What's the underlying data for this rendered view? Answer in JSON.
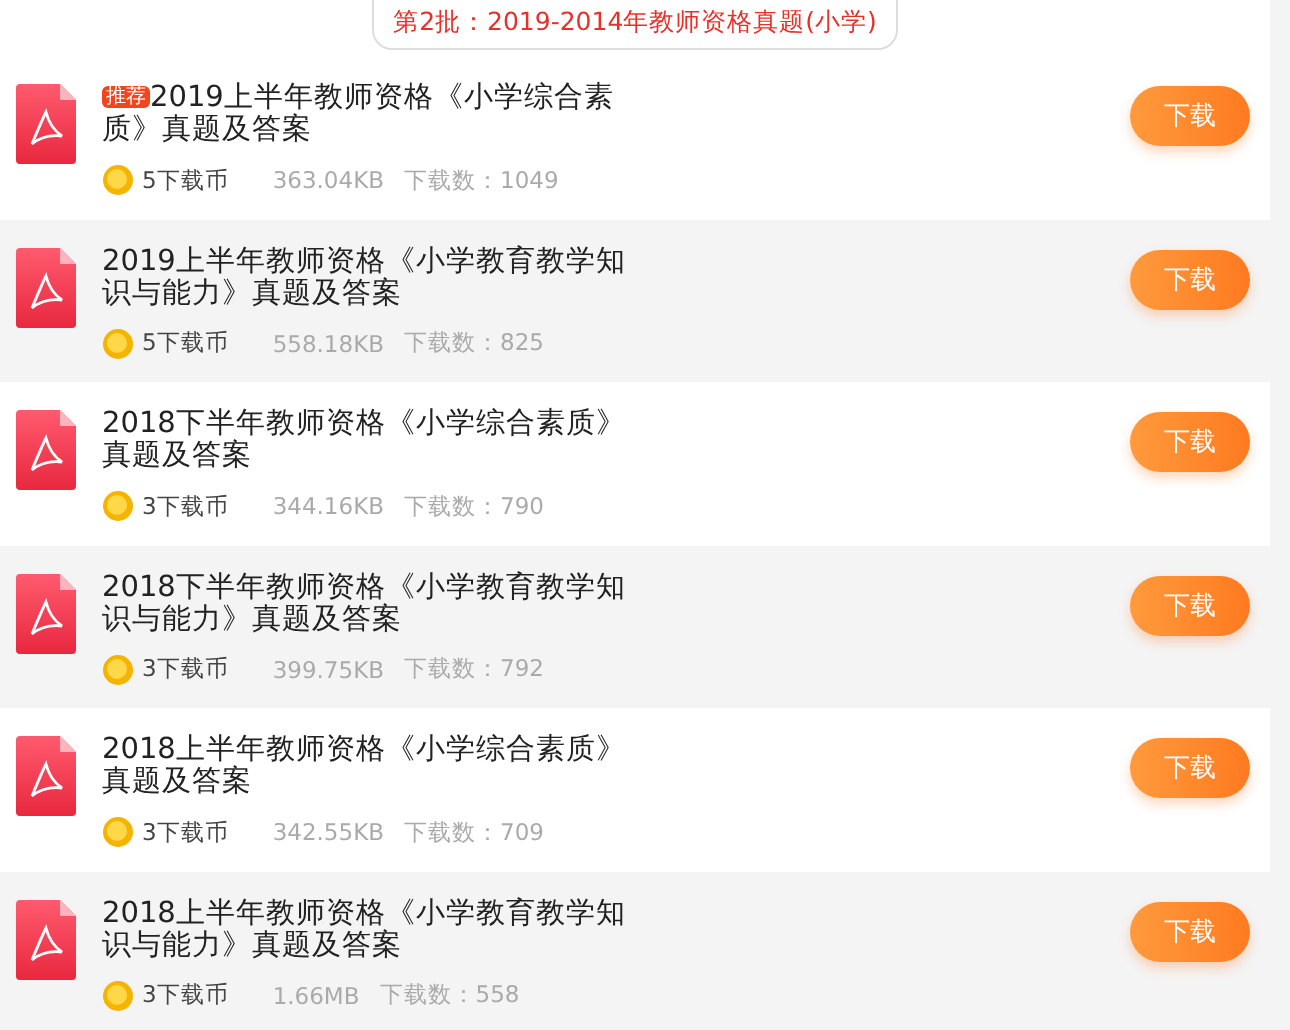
{
  "heading": "第2批：2019-2014年教师资格真题(小学)",
  "files": [
    {
      "badge": "推荐",
      "title": "2019上半年教师资格《小学综合素质》真题及答案",
      "price": "5下载币",
      "size": "363.04KB",
      "downloads": "下载数：1049",
      "button": "下载"
    },
    {
      "title": "2019上半年教师资格《小学教育教学知识与能力》真题及答案",
      "price": "5下载币",
      "size": "558.18KB",
      "downloads": "下载数：825",
      "button": "下载"
    },
    {
      "title": "2018下半年教师资格《小学综合素质》真题及答案",
      "price": "3下载币",
      "size": "344.16KB",
      "downloads": "下载数：790",
      "button": "下载"
    },
    {
      "title": "2018下半年教师资格《小学教育教学知识与能力》真题及答案",
      "price": "3下载币",
      "size": "399.75KB",
      "downloads": "下载数：792",
      "button": "下载"
    },
    {
      "title": "2018上半年教师资格《小学综合素质》真题及答案",
      "price": "3下载币",
      "size": "342.55KB",
      "downloads": "下载数：709",
      "button": "下载"
    },
    {
      "title": "2018上半年教师资格《小学教育教学知识与能力》真题及答案",
      "price": "3下载币",
      "size": "1.66MB",
      "downloads": "下载数：558",
      "button": "下载"
    }
  ]
}
